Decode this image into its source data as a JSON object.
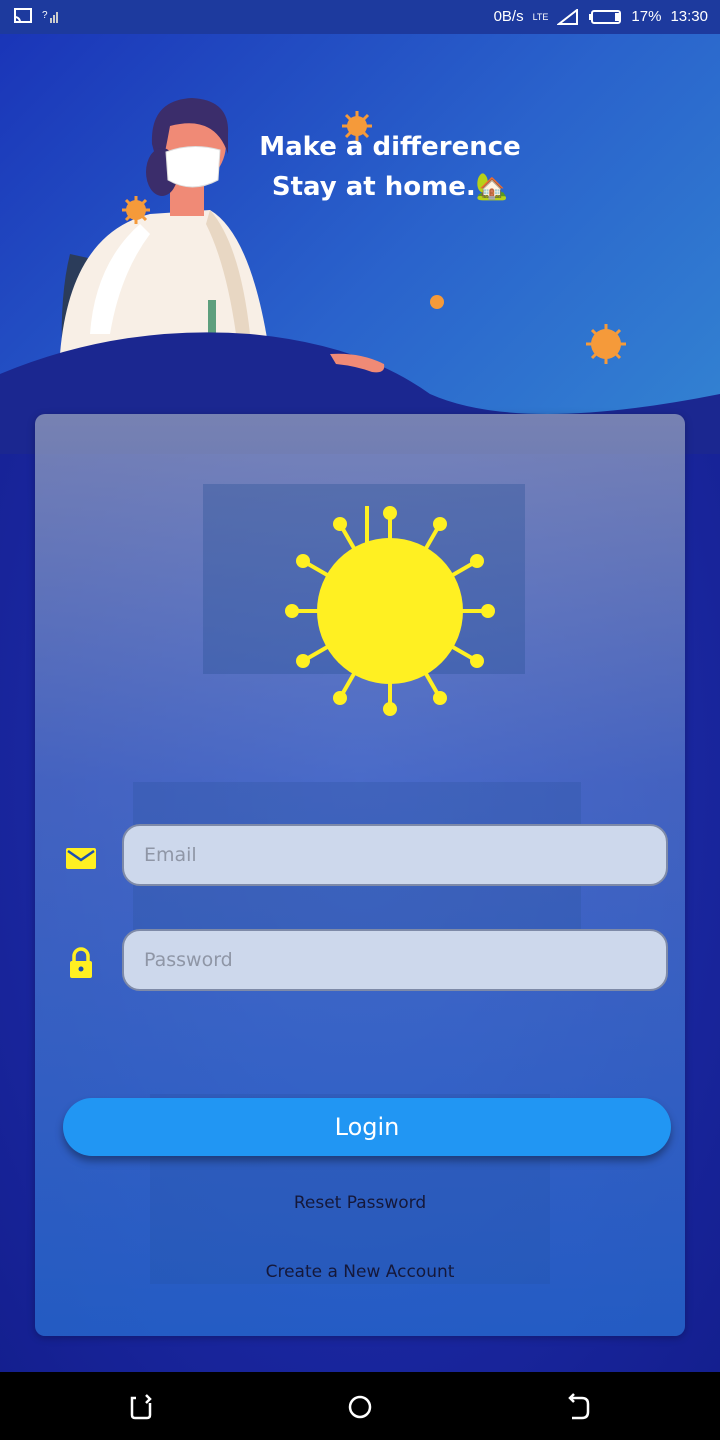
{
  "status_bar": {
    "net_speed": "0B/s",
    "network": "LTE",
    "battery": "17%",
    "time": "13:30"
  },
  "header": {
    "line1": "Make a difference",
    "line2": "Stay at home.🏡"
  },
  "form": {
    "email_placeholder": "Email",
    "password_placeholder": "Password",
    "email_value": "",
    "password_value": ""
  },
  "actions": {
    "login_label": "Login",
    "reset_label": "Reset Password",
    "create_label": "Create a New Account"
  },
  "colors": {
    "accent": "#2196f3",
    "icon_yellow": "#fff022",
    "virus_orange": "#f59a3a"
  },
  "icons": [
    "cast-icon",
    "signal-icon",
    "wifi-icon",
    "battery-icon",
    "email-icon",
    "lock-icon",
    "virus-logo-icon",
    "back-nav-icon",
    "home-nav-icon",
    "recents-nav-icon"
  ]
}
